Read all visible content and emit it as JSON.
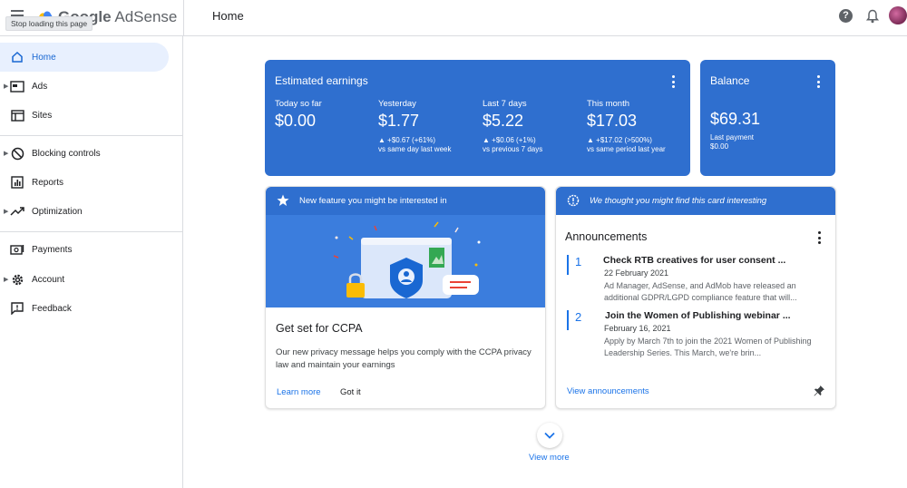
{
  "topbar": {
    "app_name_prefix": "Google",
    "app_name_suffix": "AdSense",
    "tooltip": "Stop loading this page",
    "page_title": "Home",
    "help_glyph": "?"
  },
  "sidebar": {
    "items": [
      {
        "label": "Home",
        "icon": "home-icon"
      },
      {
        "label": "Ads",
        "icon": "ads-icon"
      },
      {
        "label": "Sites",
        "icon": "sites-icon"
      },
      {
        "label": "Blocking controls",
        "icon": "block-icon"
      },
      {
        "label": "Reports",
        "icon": "reports-icon"
      },
      {
        "label": "Optimization",
        "icon": "optimization-icon"
      },
      {
        "label": "Payments",
        "icon": "payments-icon"
      },
      {
        "label": "Account",
        "icon": "gear-icon"
      },
      {
        "label": "Feedback",
        "icon": "feedback-icon"
      }
    ]
  },
  "earnings": {
    "title": "Estimated earnings",
    "stats": [
      {
        "label": "Today so far",
        "value": "$0.00",
        "change": "",
        "compare": ""
      },
      {
        "label": "Yesterday",
        "value": "$1.77",
        "change": "▲ +$0.67 (+61%)",
        "compare": "vs same day last week"
      },
      {
        "label": "Last 7 days",
        "value": "$5.22",
        "change": "▲ +$0.06 (+1%)",
        "compare": "vs previous 7 days"
      },
      {
        "label": "This month",
        "value": "$17.03",
        "change": "▲ +$17.02 (>500%)",
        "compare": "vs same period last year"
      }
    ]
  },
  "balance": {
    "title": "Balance",
    "value": "$69.31",
    "last_payment_label": "Last payment",
    "last_payment_value": "$0.00"
  },
  "feature_card": {
    "banner": "New feature you might be interested in",
    "heading": "Get set for CCPA",
    "body": "Our new privacy message helps you comply with the CCPA privacy law and maintain your earnings",
    "learn_more": "Learn more",
    "got_it": "Got it"
  },
  "announcements": {
    "banner": "We thought you might find this card interesting",
    "title": "Announcements",
    "items": [
      {
        "num": "1",
        "heading": "Check RTB creatives for user consent ...",
        "date": "22 February 2021",
        "body": "Ad Manager, AdSense, and AdMob have released an additional GDPR/LGPD compliance feature that will..."
      },
      {
        "num": "2",
        "heading": "Join the Women of Publishing webinar ...",
        "date": "February 16, 2021",
        "body": "Apply by March 7th to join the 2021 Women of Publishing Leadership Series. This March, we're brin..."
      }
    ],
    "view_link": "View announcements"
  },
  "view_more": "View more",
  "colors": {
    "accent": "#2f6fcf",
    "link": "#1a73e8"
  }
}
